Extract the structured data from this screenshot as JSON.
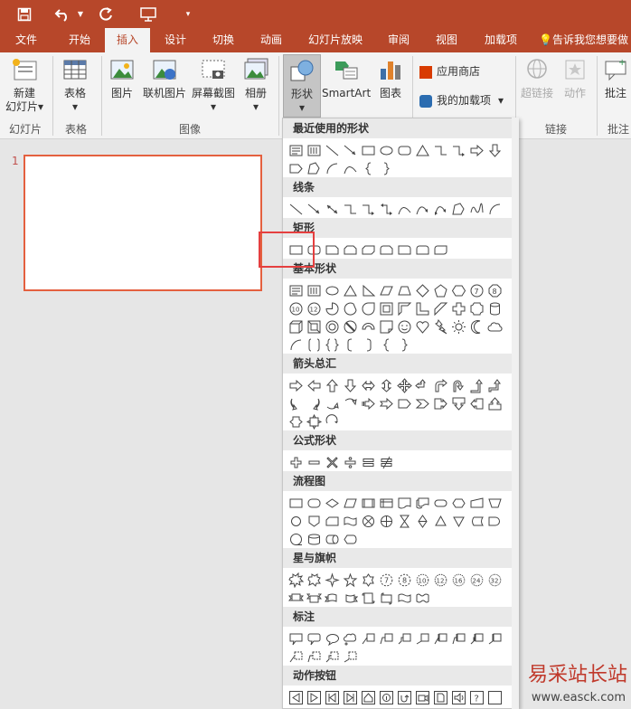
{
  "ribbon_tabs": [
    "文件",
    "开始",
    "插入",
    "设计",
    "切换",
    "动画",
    "幻灯片放映",
    "审阅",
    "视图",
    "加载项",
    "告诉我您想要做"
  ],
  "active_tab": "插入",
  "ribbon": {
    "new_slide_l1": "新建",
    "new_slide_l2": "幻灯片",
    "table": "表格",
    "picture": "图片",
    "online_pic": "联机图片",
    "screenshot": "屏幕截图",
    "album": "相册",
    "shapes": "形状",
    "smartart": "SmartArt",
    "chart": "图表",
    "store": "应用商店",
    "addins": "我的加载项",
    "hyperlink": "超链接",
    "action": "动作",
    "comment": "批注"
  },
  "groups": {
    "slides": "幻灯片",
    "tables": "表格",
    "images": "图像",
    "links": "链接",
    "comments": "批注"
  },
  "slide_number": "1",
  "shape_sections": [
    {
      "title": "最近使用的形状",
      "rows": [
        [
          "text",
          "vtext",
          "line",
          "arrowline",
          "rect",
          "oval",
          "rrect",
          "tri",
          "elbow",
          "elbowarrow",
          "rarrow",
          "darrow"
        ],
        [
          "pentagon2",
          "freeform",
          "arc",
          "curve",
          "lbrace",
          "rbrace"
        ]
      ]
    },
    {
      "title": "线条",
      "rows": [
        [
          "line",
          "arrowline",
          "darrowline",
          "elbow",
          "elbowarrow",
          "delbow",
          "curve",
          "curvearrow",
          "dcurve",
          "freeform",
          "scribble",
          "arc"
        ]
      ]
    },
    {
      "title": "矩形",
      "rows": [
        [
          "rect",
          "rrect",
          "snip1",
          "snip2",
          "snipdiag",
          "sniprounded",
          "round1",
          "round2",
          "rounddiag"
        ]
      ]
    },
    {
      "title": "基本形状",
      "rows": [
        [
          "text",
          "vtext",
          "oval",
          "tri",
          "rtri",
          "para",
          "trap",
          "diamond",
          "pentagon",
          "hexagon",
          "heptagon",
          "octagon"
        ],
        [
          "decagon",
          "dodecagon",
          "pie",
          "chord",
          "teardrop",
          "frame",
          "halfframe",
          "lshape",
          "diagstripe",
          "cross",
          "plaque",
          "can"
        ],
        [
          "cube",
          "bevel",
          "donut",
          "nosymbol",
          "blockarc",
          "folded",
          "smiley",
          "heart",
          "bolt",
          "sun",
          "moon",
          "cloud"
        ],
        [
          "arc",
          "bracket2",
          "brace2",
          "lbracket",
          "rbracket",
          "lbrace",
          "rbrace"
        ]
      ]
    },
    {
      "title": "箭头总汇",
      "rows": [
        [
          "rarrow",
          "larrow",
          "uarrow",
          "darrow",
          "lrarrow",
          "udarrow",
          "quadarrow",
          "lrudarrow",
          "bentarrow",
          "uturnarrow",
          "lupa",
          "bentup"
        ],
        [
          "curvedr",
          "curvedl",
          "curvedu",
          "curvedd",
          "stripedr",
          "notchedr",
          "pentagonarrow",
          "chevron",
          "rcallout",
          "dcallout",
          "lcallout",
          "ucallout"
        ],
        [
          "lrcallout",
          "quadcallout",
          "circulararrow"
        ]
      ]
    },
    {
      "title": "公式形状",
      "rows": [
        [
          "plus",
          "minus",
          "mult",
          "divide",
          "equal",
          "notequal"
        ]
      ]
    },
    {
      "title": "流程图",
      "rows": [
        [
          "fprocess",
          "falt",
          "fdecision",
          "fdata",
          "fpredef",
          "finternal",
          "fdoc",
          "fmultidoc",
          "fterm",
          "fprep",
          "fmanual",
          "fmanop"
        ],
        [
          "fconn",
          "foffpage",
          "fcard",
          "fpunch",
          "fsumming",
          "for",
          "fcollate",
          "fsort",
          "fextract",
          "fmerge",
          "fstored",
          "fdelay"
        ],
        [
          "fseq",
          "fmagdisk",
          "fdirect",
          "fdisplay"
        ]
      ]
    },
    {
      "title": "星与旗帜",
      "rows": [
        [
          "exp1",
          "exp2",
          "star4",
          "star5",
          "star6",
          "star7",
          "star8",
          "star10",
          "star12",
          "star16",
          "star24",
          "star32"
        ],
        [
          "ribbon1",
          "ribbon2",
          "cribbon1",
          "cribbon2",
          "vscroll",
          "hscroll",
          "wave",
          "dwave"
        ]
      ]
    },
    {
      "title": "标注",
      "rows": [
        [
          "rectcallout",
          "rrectcallout",
          "ovalcallout",
          "cloudcallout",
          "lcallout1",
          "lcallout2",
          "lcallout3",
          "lcallout4",
          "acallout1",
          "acallout2",
          "acallout3",
          "acallout4"
        ],
        [
          "bcallout1",
          "bcallout2",
          "bcallout3",
          "bcallout4"
        ]
      ]
    },
    {
      "title": "动作按钮",
      "rows": [
        [
          "abback",
          "abfwd",
          "abbegin",
          "abend",
          "abhome",
          "abinfo",
          "abreturn",
          "abmovie",
          "abdoc",
          "absound",
          "abhelp",
          "abblank"
        ]
      ]
    }
  ],
  "watermark": {
    "text": "易采站长站",
    "url": "www.easck.com"
  },
  "colors": {
    "accent": "#b7472a",
    "highlight": "#e53f3f"
  }
}
